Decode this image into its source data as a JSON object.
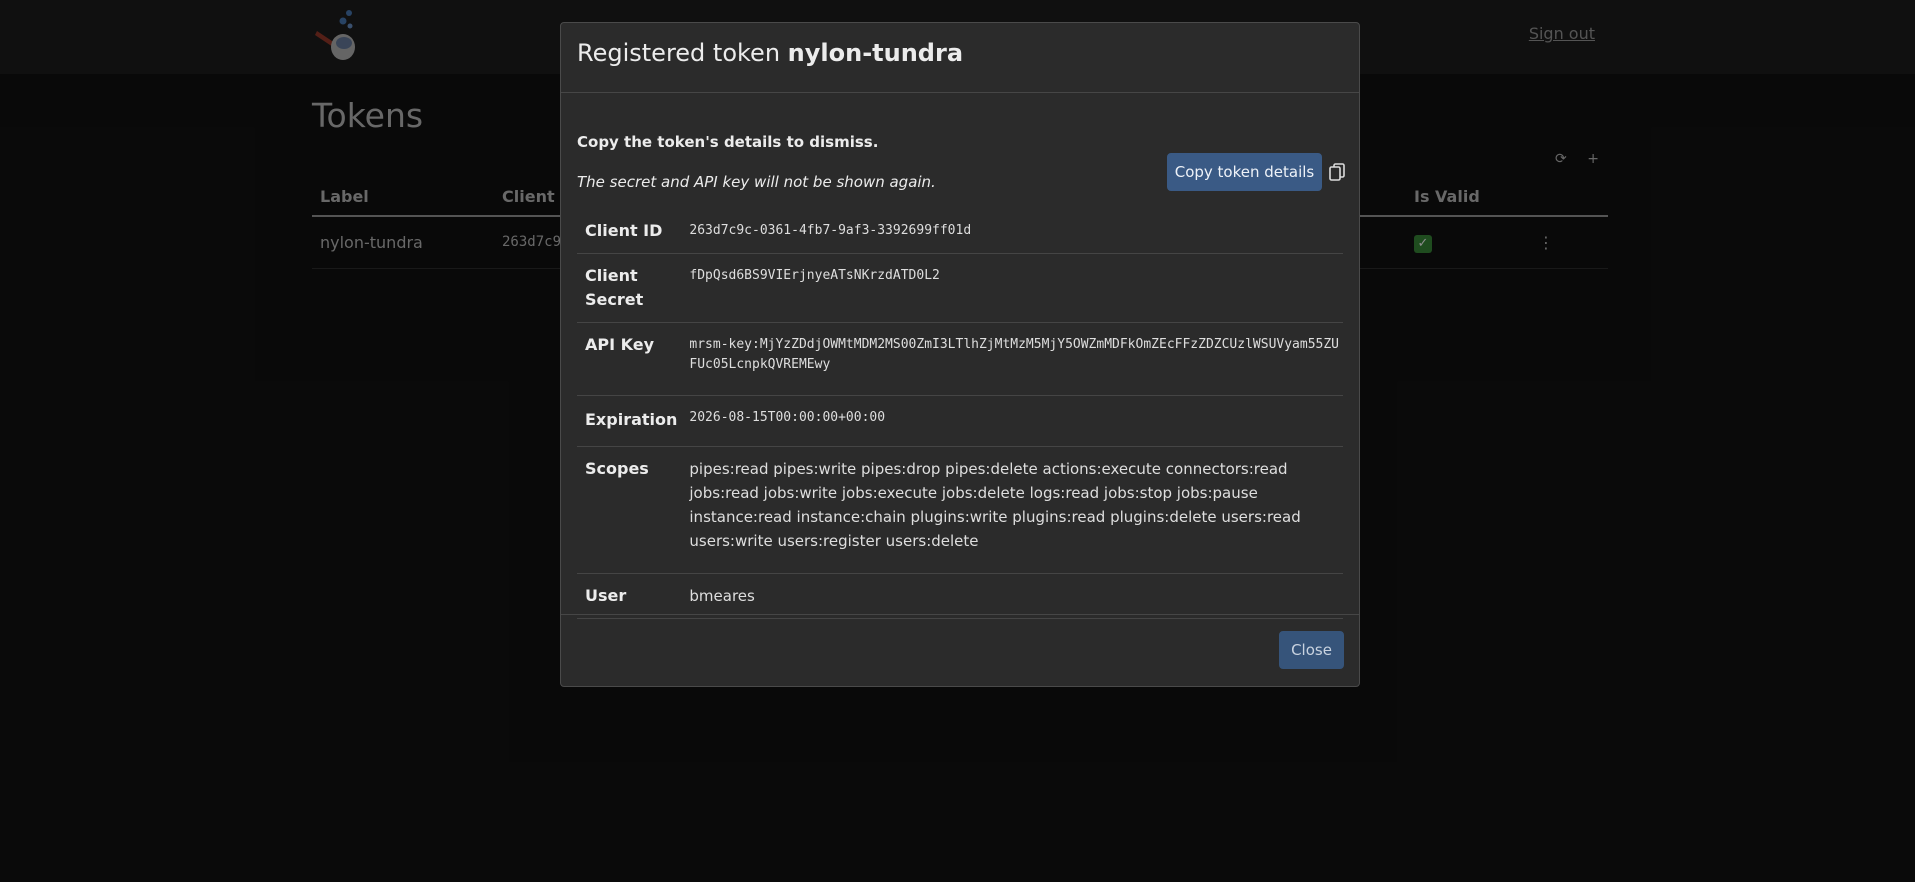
{
  "nav": {
    "signout_label": "Sign out"
  },
  "page": {
    "title": "Tokens",
    "table_actions": {
      "refresh_icon": "⟳",
      "add_icon": "+"
    },
    "table": {
      "columns": [
        "Label",
        "Client ID",
        "Is Valid"
      ],
      "rows": [
        {
          "label": "nylon-tundra",
          "client_id": "263d7c9",
          "is_valid": "✓",
          "menu_icon": "⋮"
        }
      ]
    }
  },
  "modal": {
    "title_prefix": "Registered token",
    "token_name": "nylon-tundra",
    "dismiss_message": "Copy the token's details to dismiss.",
    "secret_note": "The secret and API key will not be shown again.",
    "copy_button_label": "Copy token details",
    "details": {
      "client_id_label": "Client ID",
      "client_id": "263d7c9c-0361-4fb7-9af3-3392699ff01d",
      "client_secret_label": "Client Secret",
      "client_secret": "fDpQsd6BS9VIErjnyeATsNKrzdATD0L2",
      "api_key_label": "API Key",
      "api_key": "mrsm-key:MjYzZDdjOWMtMDM2MS00ZmI3LTlhZjMtMzM5MjY5OWZmMDFkOmZEcFFzZDZCUzlWSUVyam55ZUFUc05LcnpkQVREMEwy",
      "expiration_label": "Expiration",
      "expiration": "2026-08-15T00:00:00+00:00",
      "scopes_label": "Scopes",
      "scopes": "pipes:read pipes:write pipes:drop pipes:delete actions:execute connectors:read jobs:read jobs:write jobs:execute jobs:delete logs:read jobs:stop jobs:pause instance:read instance:chain plugins:write plugins:read plugins:delete users:read users:write users:register users:delete",
      "user_label": "User",
      "user": "bmeares"
    },
    "close_button_label": "Close"
  }
}
